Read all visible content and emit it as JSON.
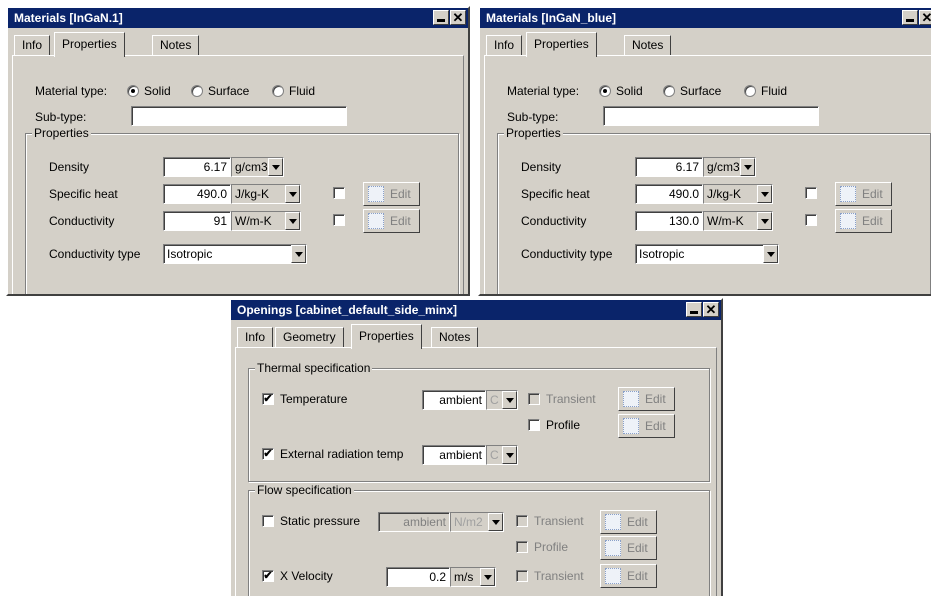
{
  "win1": {
    "title": "Materials [InGaN.1]",
    "tabs": [
      "Info",
      "Properties",
      "Notes"
    ],
    "material_type_label": "Material type:",
    "radio_options": [
      "Solid",
      "Surface",
      "Fluid"
    ],
    "selected_radio": "Solid",
    "subtype_label": "Sub-type:",
    "subtype_value": "",
    "properties_group": "Properties",
    "density_label": "Density",
    "density_value": "6.17",
    "density_unit": "g/cm3",
    "specific_heat_label": "Specific heat",
    "specific_heat_value": "490.0",
    "specific_heat_unit": "J/kg-K",
    "conductivity_label": "Conductivity",
    "conductivity_value": "91",
    "conductivity_unit": "W/m-K",
    "edit_label": "Edit",
    "conductivity_type_label": "Conductivity type",
    "conductivity_type_value": "Isotropic"
  },
  "win2": {
    "title": "Materials [InGaN_blue]",
    "tabs": [
      "Info",
      "Properties",
      "Notes"
    ],
    "material_type_label": "Material type:",
    "radio_options": [
      "Solid",
      "Surface",
      "Fluid"
    ],
    "selected_radio": "Solid",
    "subtype_label": "Sub-type:",
    "subtype_value": "",
    "properties_group": "Properties",
    "density_label": "Density",
    "density_value": "6.17",
    "density_unit": "g/cm3",
    "specific_heat_label": "Specific heat",
    "specific_heat_value": "490.0",
    "specific_heat_unit": "J/kg-K",
    "conductivity_label": "Conductivity",
    "conductivity_value": "130.0",
    "conductivity_unit": "W/m-K",
    "edit_label": "Edit",
    "conductivity_type_label": "Conductivity type",
    "conductivity_type_value": "Isotropic"
  },
  "win3": {
    "title": "Openings [cabinet_default_side_minx]",
    "tabs": [
      "Info",
      "Geometry",
      "Properties",
      "Notes"
    ],
    "thermal_group": "Thermal specification",
    "temperature_label": "Temperature",
    "temperature_checked": true,
    "temperature_value": "ambient",
    "temperature_unit": "C",
    "transient_label": "Transient",
    "profile_label": "Profile",
    "edit_label": "Edit",
    "ext_rad_label": "External radiation temp",
    "ext_rad_checked": true,
    "ext_rad_value": "ambient",
    "ext_rad_unit": "C",
    "flow_group": "Flow specification",
    "static_pressure_label": "Static pressure",
    "static_pressure_checked": false,
    "static_pressure_value": "ambient",
    "static_pressure_unit": "N/m2",
    "xvel_label": "X Velocity",
    "xvel_checked": true,
    "xvel_value": "0.2",
    "xvel_unit": "m/s"
  },
  "icons": {
    "minimize": "minimize-icon",
    "close": "close-icon",
    "dropdown": "chevron-down-icon",
    "edit": "edit-icon",
    "check": "✔"
  },
  "colors": {
    "titlebar": "#0a246a",
    "window_face": "#d4d0c8"
  }
}
